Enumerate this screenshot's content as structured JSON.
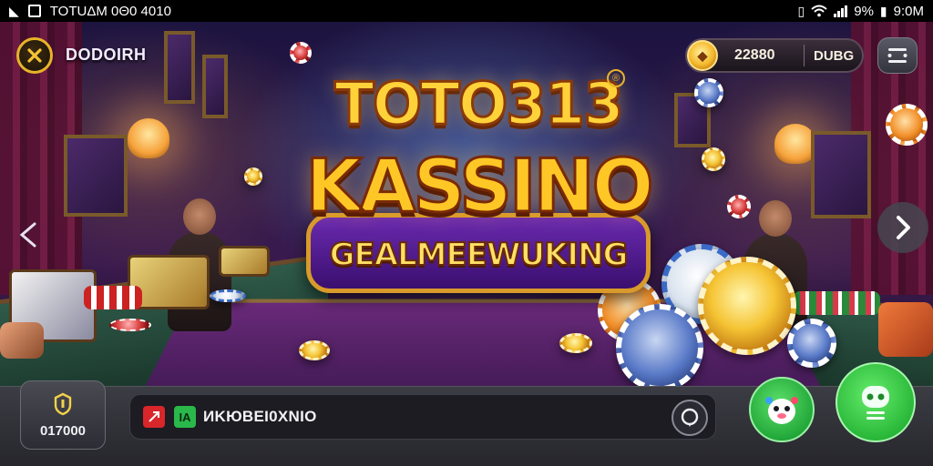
{
  "status_bar": {
    "app_title": "TOTUΔM 0Θ0 4010",
    "battery": "9%",
    "time": "9:0M"
  },
  "header": {
    "brand_label": "DODOIRH",
    "balance": "22880",
    "currency": "DUBG"
  },
  "logo": {
    "line1": "TOTO313",
    "line2": "KASSINO",
    "tagline": "GEALMEEWUKING",
    "trademark": "®"
  },
  "bottom": {
    "wallet_value": "017000",
    "search_text": "ИKЮΒΕΙ0ΧΝΙΟ",
    "badge_text": "ΙΑ"
  },
  "colors": {
    "accent_gold": "#f5c434",
    "action_green": "#2ab83a",
    "bar_bg": "#2e2e36"
  },
  "icons": {
    "back": "close-x-icon",
    "menu": "hamburger-icon",
    "next": "chevron-right-icon",
    "chat": "chat-bubble-icon",
    "bot": "robot-icon",
    "mascot": "mascot-icon"
  }
}
